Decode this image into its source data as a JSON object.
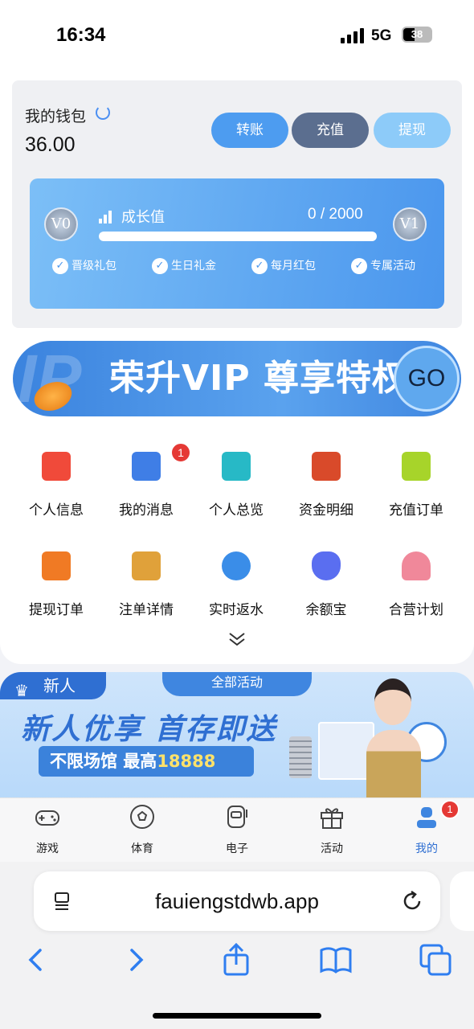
{
  "status_bar": {
    "time": "16:34",
    "network": "5G",
    "battery": "38"
  },
  "wallet": {
    "title": "我的钱包",
    "balance": "36.00",
    "buttons": {
      "transfer": "转账",
      "deposit": "充值",
      "withdraw": "提现"
    },
    "colors": {
      "transfer": "#4d9cf0",
      "deposit": "#5b6e8f",
      "withdraw": "#8dcbf9"
    }
  },
  "vip_card": {
    "current_level": "V0",
    "next_level": "V1",
    "growth_label": "成长值",
    "growth_value": "0 / 2000",
    "progress": 0,
    "perks": [
      "晋级礼包",
      "生日礼金",
      "每月红包",
      "专属活动"
    ]
  },
  "vip_banner": {
    "text": "荣升VIP 尊享特权",
    "go": "GO"
  },
  "grid": {
    "items": [
      {
        "label": "个人信息",
        "icon": "id-card-icon",
        "color": "#f04a3a"
      },
      {
        "label": "我的消息",
        "icon": "message-icon",
        "color": "#3f7ee6",
        "badge": "1"
      },
      {
        "label": "个人总览",
        "icon": "profile-icon",
        "color": "#27b9c6"
      },
      {
        "label": "资金明细",
        "icon": "ledger-icon",
        "color": "#d94a2a"
      },
      {
        "label": "充值订单",
        "icon": "order-icon",
        "color": "#a7d42a"
      },
      {
        "label": "提现订单",
        "icon": "withdraw-order-icon",
        "color": "#f07a24"
      },
      {
        "label": "注单详情",
        "icon": "bet-detail-icon",
        "color": "#e0a13a"
      },
      {
        "label": "实时返水",
        "icon": "rebate-icon",
        "color": "#3a8de8"
      },
      {
        "label": "余额宝",
        "icon": "money-bag-icon",
        "color": "#5a6ef0"
      },
      {
        "label": "合营计划",
        "icon": "partner-icon",
        "color": "#f0889a"
      }
    ]
  },
  "promo": {
    "tag": "新人",
    "all_activities": "全部活动",
    "headline": "新人优享 首存即送",
    "sub_prefix": "不限场馆 最高",
    "sub_amount": "18888"
  },
  "tabbar": {
    "tabs": [
      {
        "label": "游戏",
        "icon": "gamepad-icon"
      },
      {
        "label": "体育",
        "icon": "soccer-ball-icon"
      },
      {
        "label": "电子",
        "icon": "slot-machine-icon"
      },
      {
        "label": "活动",
        "icon": "gift-icon"
      },
      {
        "label": "我的",
        "icon": "user-icon",
        "badge": "1",
        "active": true
      }
    ],
    "active_color": "#2f6fd2"
  },
  "browser": {
    "url": "fauiengstdwb.app"
  }
}
